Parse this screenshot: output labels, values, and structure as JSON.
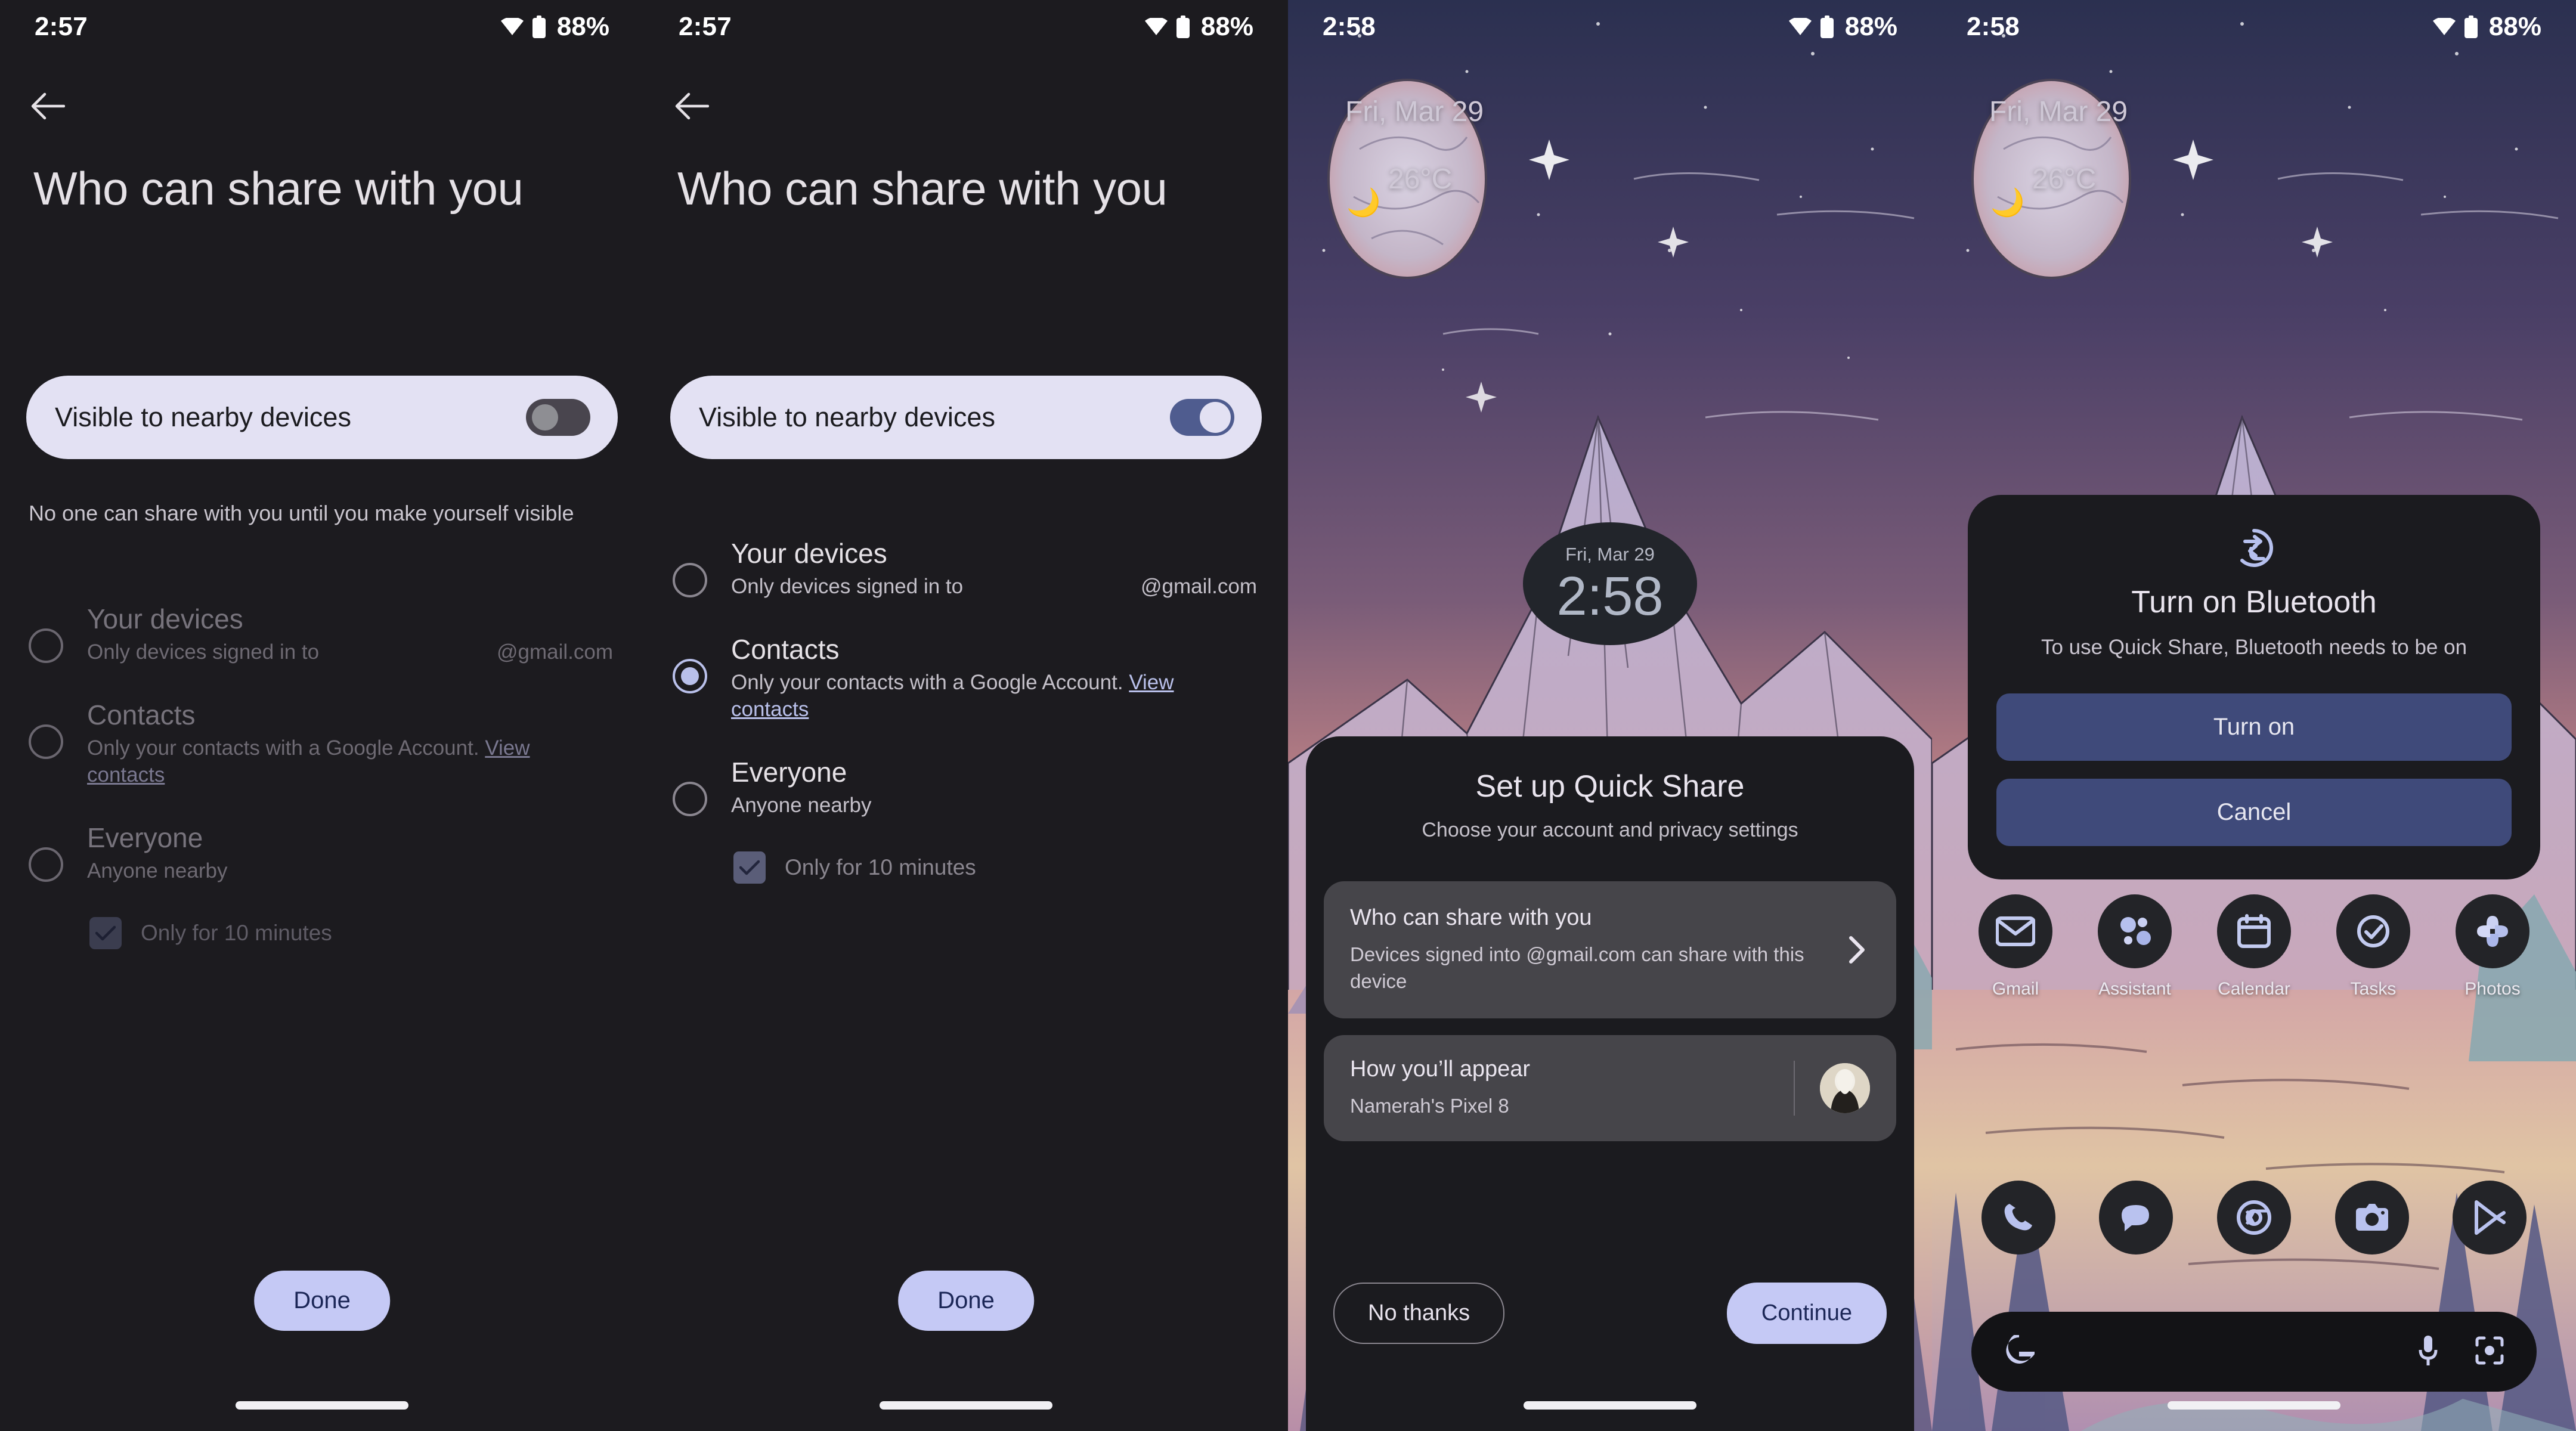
{
  "panels": {
    "p1": {
      "status": {
        "time": "2:57",
        "battery": "88%",
        "wifi_icon": "wifi-icon",
        "battery_icon": "battery-icon"
      },
      "back_icon": "back-arrow-icon",
      "title": "Who can share with you",
      "visible_card": {
        "label": "Visible to nearby devices",
        "toggle_state": "off"
      },
      "hint": "No one can share with you until you make yourself visible",
      "options": [
        {
          "title": "Your devices",
          "sub": "Only devices signed in to",
          "mail": "@gmail.com",
          "selected": false,
          "link": ""
        },
        {
          "title": "Contacts",
          "sub": "Only your contacts with a Google Account.",
          "link": "View contacts",
          "selected": false,
          "mail": ""
        },
        {
          "title": "Everyone",
          "sub": "Anyone nearby",
          "selected": false,
          "link": "",
          "mail": ""
        }
      ],
      "checkbox": {
        "label": "Only for 10 minutes",
        "checked": true
      },
      "done_label": "Done"
    },
    "p2": {
      "status": {
        "time": "2:57",
        "battery": "88%"
      },
      "title": "Who can share with you",
      "visible_card": {
        "label": "Visible to nearby devices",
        "toggle_state": "on"
      },
      "options": [
        {
          "title": "Your devices",
          "sub": "Only devices signed in to",
          "mail": "@gmail.com",
          "selected": false,
          "link": ""
        },
        {
          "title": "Contacts",
          "sub": "Only your contacts with a Google Account.",
          "link": "View contacts",
          "selected": true,
          "mail": ""
        },
        {
          "title": "Everyone",
          "sub": "Anyone nearby",
          "selected": false,
          "link": "",
          "mail": ""
        }
      ],
      "checkbox": {
        "label": "Only for 10 minutes",
        "checked": true
      },
      "done_label": "Done"
    },
    "p3": {
      "status": {
        "time": "2:58",
        "battery": "88%"
      },
      "lock_widget": {
        "date": "Fri, Mar 29",
        "temp": "26°C",
        "weather_icon": "moon-cloud-icon"
      },
      "clock": {
        "date": "Fri, Mar 29",
        "time": "2:58"
      },
      "sheet": {
        "title": "Set up Quick Share",
        "subtitle": "Choose your account and privacy settings",
        "cards": [
          {
            "title": "Who can share with you",
            "sub": "Devices signed into           @gmail.com can share with this device",
            "chevron_icon": "chevron-right-icon"
          },
          {
            "title": "How you’ll appear",
            "sub": "Namerah's Pixel 8",
            "avatar_icon": "user-avatar"
          }
        ],
        "secondary_label": "No thanks",
        "primary_label": "Continue"
      }
    },
    "p4": {
      "status": {
        "time": "2:58",
        "battery": "88%"
      },
      "lock_widget": {
        "date": "Fri, Mar 29",
        "temp": "26°C"
      },
      "dialog": {
        "icon": "quick-share-icon",
        "title": "Turn on Bluetooth",
        "message": "To use Quick Share, Bluetooth needs to be on",
        "primary_label": "Turn on",
        "secondary_label": "Cancel"
      },
      "app_row": [
        {
          "label": "Gmail",
          "icon": "gmail-icon"
        },
        {
          "label": "Assistant",
          "icon": "assistant-icon"
        },
        {
          "label": "Calendar",
          "icon": "calendar-icon"
        },
        {
          "label": "Tasks",
          "icon": "tasks-icon"
        },
        {
          "label": "Photos",
          "icon": "photos-icon"
        }
      ],
      "dock": [
        {
          "icon": "phone-icon"
        },
        {
          "icon": "messages-icon"
        },
        {
          "icon": "chrome-icon"
        },
        {
          "icon": "camera-icon"
        },
        {
          "icon": "play-store-icon"
        }
      ],
      "search": {
        "google_icon": "google-g-icon",
        "mic_icon": "microphone-icon",
        "lens_icon": "lens-icon"
      }
    }
  },
  "colors": {
    "surface_dark": "#1c1b1f",
    "accent_lavender": "#c5c9f5",
    "card_light": "#e3e1f3",
    "radio_active": "#b9c0ea",
    "dialog_button": "#3f4a7a"
  }
}
